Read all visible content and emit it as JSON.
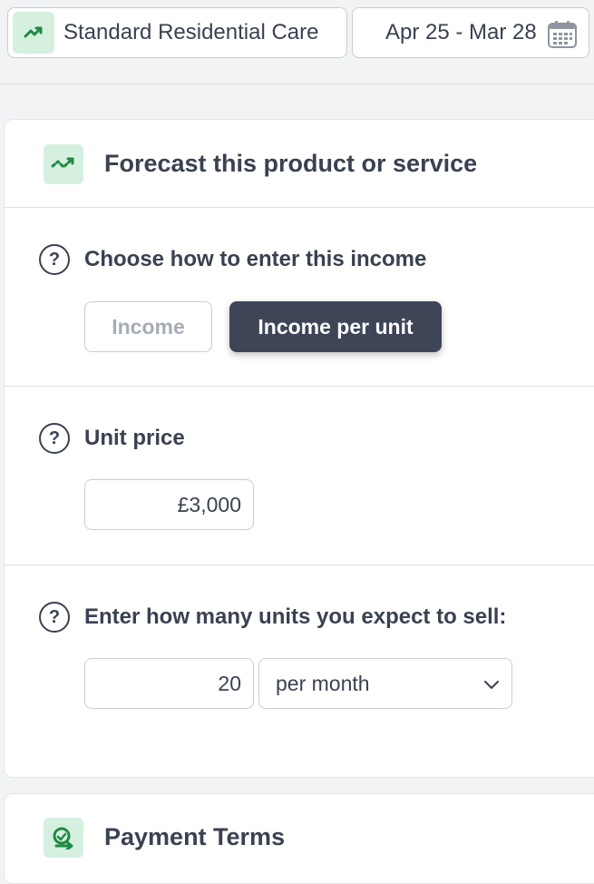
{
  "topbar": {
    "product": {
      "label": "Standard Residential Care",
      "icon": "trend-up-icon"
    },
    "date_range": {
      "label": "Apr 25 - Mar 28",
      "icon": "calendar-icon"
    }
  },
  "forecast_card": {
    "title": "Forecast this product or service",
    "icon": "forecast-trend-icon",
    "entry_method": {
      "label": "Choose how to enter this income",
      "options": [
        "Income",
        "Income per unit"
      ],
      "selected": "Income per unit"
    },
    "unit_price": {
      "label": "Unit price",
      "value": "£3,000"
    },
    "units": {
      "label": "Enter how many units you expect to sell:",
      "value": "20",
      "period": "per month"
    }
  },
  "payment_card": {
    "title": "Payment Terms",
    "icon": "payment-terms-icon"
  },
  "colors": {
    "accent_green": "#1e8a43",
    "icon_badge_bg": "#d6f0df",
    "selected_button_bg": "#3d4557",
    "text": "#3a4150"
  }
}
